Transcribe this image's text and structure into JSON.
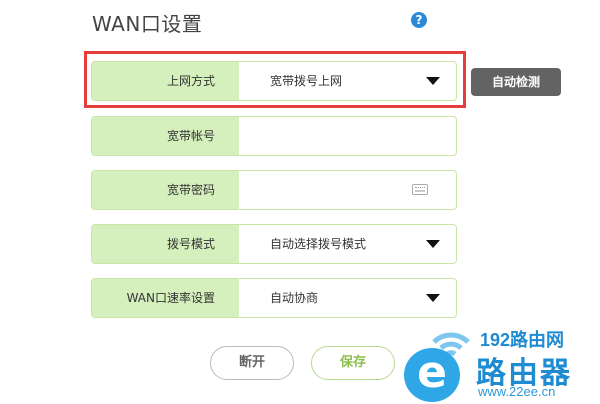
{
  "header": {
    "title": "WAN口设置"
  },
  "help": {
    "symbol": "?"
  },
  "fields": [
    {
      "label": "上网方式",
      "value": "宽带拨号上网"
    },
    {
      "label": "宽带帐号",
      "value": ""
    },
    {
      "label": "宽带密码",
      "value": ""
    },
    {
      "label": "拨号模式",
      "value": "自动选择拨号模式"
    },
    {
      "label": "WAN口速率设置",
      "value": "自动协商"
    }
  ],
  "buttons": {
    "auto_detect": "自动检测",
    "disconnect": "断开",
    "save": "保存"
  },
  "watermark": {
    "site": "192路由网",
    "name": "路由器",
    "url": "www.22ee.cn",
    "logo_letter": "e"
  },
  "colors": {
    "label_bg": "#d5efbd",
    "highlight": "#e53c3c",
    "accent": "#8cbf4d",
    "watermark": "#1f8bd0"
  }
}
